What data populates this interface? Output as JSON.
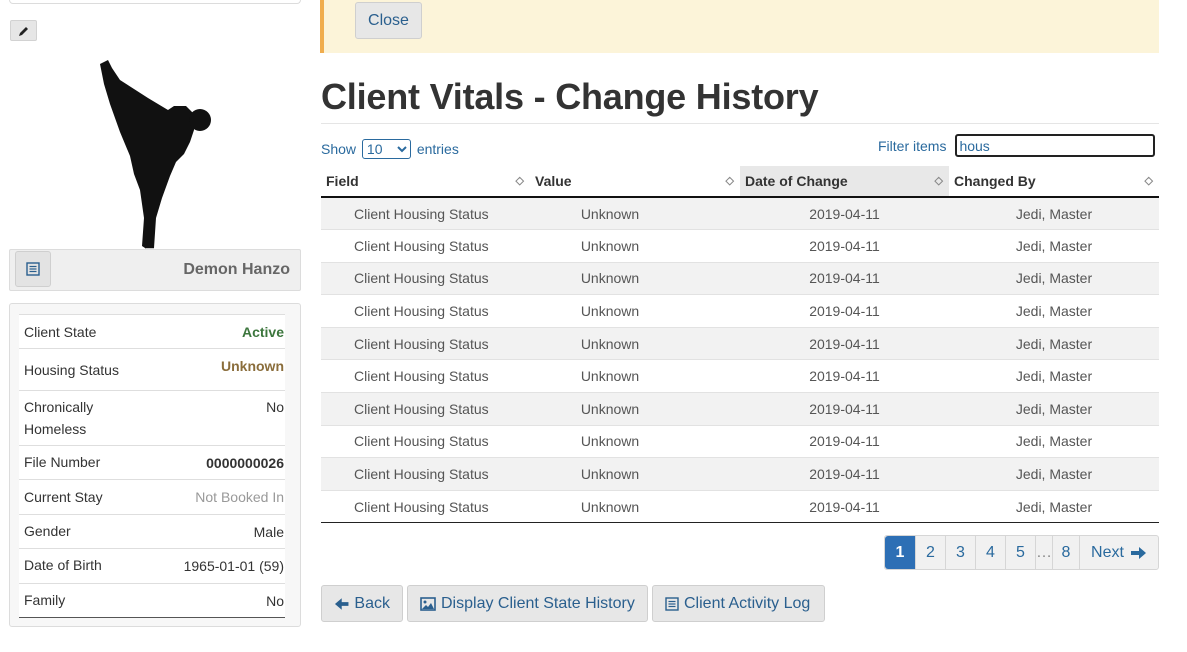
{
  "sidebar": {
    "client_name": "Demon Hanzo",
    "fields": [
      {
        "label": "Client State",
        "value": "Active",
        "style": "active"
      },
      {
        "label": "Housing Status",
        "value": "Unknown",
        "style": "unknown"
      },
      {
        "label": "Chronically Homeless",
        "value": "No",
        "style": "plain"
      },
      {
        "label": "File Number",
        "value": "0000000026",
        "style": "bold"
      },
      {
        "label": "Current Stay",
        "value": "Not Booked In",
        "style": "muted"
      },
      {
        "label": "Gender",
        "value": "Male",
        "style": "plain"
      },
      {
        "label": "Date of Birth",
        "value": "1965-01-01 (59)",
        "style": "plain"
      },
      {
        "label": "Family",
        "value": "No",
        "style": "plain"
      }
    ]
  },
  "alert": {
    "close_label": "Close"
  },
  "main": {
    "title": "Client Vitals - Change History",
    "show_label": "Show",
    "entries_label": "entries",
    "page_size": "10",
    "filter_label": "Filter items",
    "filter_value": "hous"
  },
  "table": {
    "columns": [
      "Field",
      "Value",
      "Date of Change",
      "Changed By"
    ],
    "rows": [
      [
        "Client Housing Status",
        "Unknown",
        "2019-04-11",
        "Jedi, Master"
      ],
      [
        "Client Housing Status",
        "Unknown",
        "2019-04-11",
        "Jedi, Master"
      ],
      [
        "Client Housing Status",
        "Unknown",
        "2019-04-11",
        "Jedi, Master"
      ],
      [
        "Client Housing Status",
        "Unknown",
        "2019-04-11",
        "Jedi, Master"
      ],
      [
        "Client Housing Status",
        "Unknown",
        "2019-04-11",
        "Jedi, Master"
      ],
      [
        "Client Housing Status",
        "Unknown",
        "2019-04-11",
        "Jedi, Master"
      ],
      [
        "Client Housing Status",
        "Unknown",
        "2019-04-11",
        "Jedi, Master"
      ],
      [
        "Client Housing Status",
        "Unknown",
        "2019-04-11",
        "Jedi, Master"
      ],
      [
        "Client Housing Status",
        "Unknown",
        "2019-04-11",
        "Jedi, Master"
      ],
      [
        "Client Housing Status",
        "Unknown",
        "2019-04-11",
        "Jedi, Master"
      ]
    ]
  },
  "pagination": {
    "pages": [
      "1",
      "2",
      "3",
      "4",
      "5",
      "…",
      "8"
    ],
    "current": "1",
    "next_label": "Next"
  },
  "actions": {
    "back_label": "Back",
    "state_history_label": "Display Client State History",
    "activity_log_label": "Client Activity Log"
  },
  "colors": {
    "accent": "#2d6fb5",
    "alert_bg": "#fcf4d9",
    "alert_border": "#f0ad4e",
    "active": "#3c763d",
    "unknown": "#8a6d3b"
  },
  "icons": [
    "pencil-icon",
    "list-icon",
    "sort-icon",
    "arrow-left-icon",
    "image-icon",
    "list-icon",
    "arrow-right-icon"
  ]
}
